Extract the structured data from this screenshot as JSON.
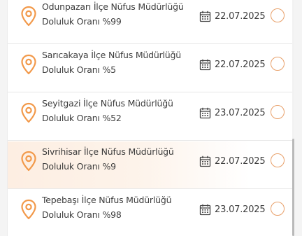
{
  "colors": {
    "accent": "#f2994a",
    "text": "#3d3d3d",
    "radio_border": "#e8a06a",
    "selected_bg": "#fdeee2"
  },
  "icons": {
    "location": "location-pin-icon",
    "date": "calendar-icon"
  },
  "offices": [
    {
      "name": "Odunpazarı İlçe Nüfus Müdürlüğü",
      "fill_text": "Doluluk Oranı %99",
      "date": "22.07.2025",
      "selected": false,
      "checked": false
    },
    {
      "name": "Sarıcakaya İlçe Nüfus Müdürlüğü",
      "fill_text": "Doluluk Oranı %5",
      "date": "22.07.2025",
      "selected": false,
      "checked": false
    },
    {
      "name": "Seyitgazi İlçe Nüfus Müdürlüğü",
      "fill_text": "Doluluk Oranı %52",
      "date": "23.07.2025",
      "selected": false,
      "checked": false
    },
    {
      "name": "Sivrihisar İlçe Nüfus Müdürlüğü",
      "fill_text": "Doluluk Oranı %9",
      "date": "22.07.2025",
      "selected": true,
      "checked": false
    },
    {
      "name": "Tepebaşı İlçe Nüfus Müdürlüğü",
      "fill_text": "Doluluk Oranı %98",
      "date": "23.07.2025",
      "selected": false,
      "checked": false
    }
  ]
}
